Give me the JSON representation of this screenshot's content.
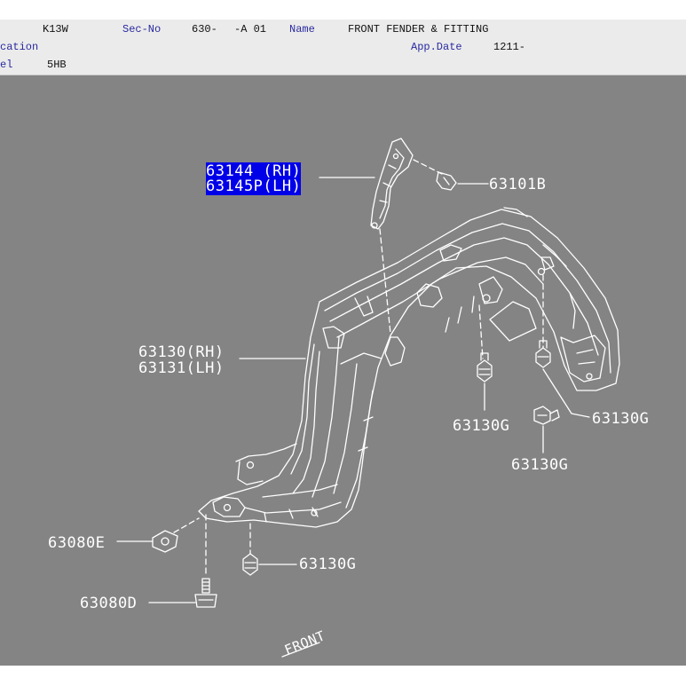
{
  "header": {
    "model_code": "K13W",
    "sec_no_label": "Sec-No",
    "sec_no_value": "630-",
    "sec_no_suffix": "-A 01",
    "name_label": "Name",
    "name_value": "FRONT FENDER & FITTING",
    "application_label": "cation",
    "app_date_label": "App.Date",
    "app_date_value": "1211-",
    "model_label": "el",
    "model_value": "5HB"
  },
  "diagram": {
    "selected_part_rh": "63144  (RH)",
    "selected_part_lh": "63145P(LH)",
    "labels": [
      {
        "id": "63101B",
        "text": "63101B"
      },
      {
        "id": "63130-rh",
        "text": "63130(RH)"
      },
      {
        "id": "63131-lh",
        "text": "63131(LH)"
      },
      {
        "id": "63130G-a",
        "text": "63130G"
      },
      {
        "id": "63130G-b",
        "text": "63130G"
      },
      {
        "id": "63130G-c",
        "text": "63130G"
      },
      {
        "id": "63130G-d",
        "text": "63130G"
      },
      {
        "id": "63080E",
        "text": "63080E"
      },
      {
        "id": "63080D",
        "text": "63080D"
      }
    ],
    "direction_mark": "FRONT"
  },
  "colors": {
    "canvas_bg": "#848484",
    "line": "#ffffff",
    "selection": "#0000e8",
    "header_bg": "#ebebeb",
    "header_blue": "#2a2aa0"
  }
}
